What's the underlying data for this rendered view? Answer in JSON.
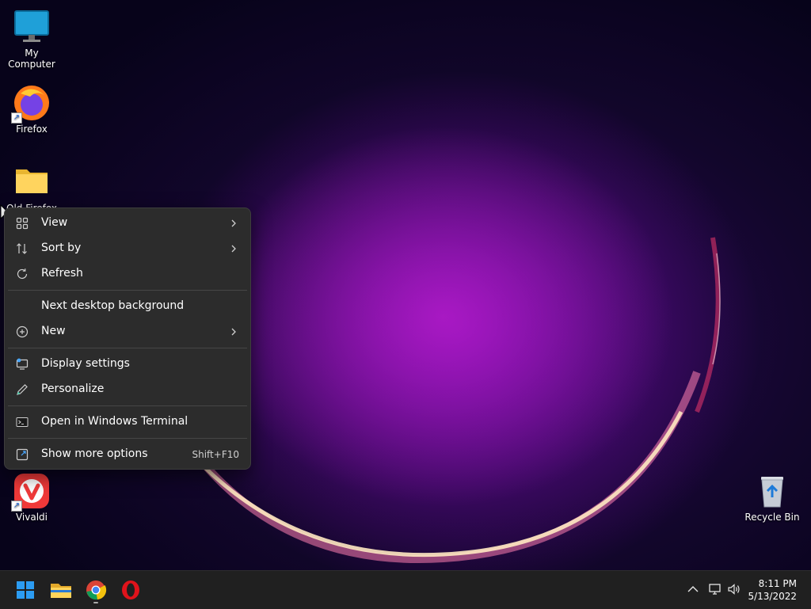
{
  "desktop": {
    "icons": [
      {
        "label": "My Computer"
      },
      {
        "label": "Firefox"
      },
      {
        "label": "Old Firefox"
      },
      {
        "label": "Vivaldi"
      },
      {
        "label": "Recycle Bin"
      }
    ]
  },
  "context_menu": {
    "items": [
      {
        "label": "View",
        "icon": "grid-icon",
        "submenu": true
      },
      {
        "label": "Sort by",
        "icon": "sort-icon",
        "submenu": true
      },
      {
        "label": "Refresh",
        "icon": "refresh-icon"
      },
      {
        "label": "Next desktop background",
        "icon": ""
      },
      {
        "label": "New",
        "icon": "plus-circle-icon",
        "submenu": true
      },
      {
        "label": "Display settings",
        "icon": "display-settings-icon"
      },
      {
        "label": "Personalize",
        "icon": "pencil-icon"
      },
      {
        "label": "Open in Windows Terminal",
        "icon": "terminal-icon"
      },
      {
        "label": "Show more options",
        "icon": "expand-icon",
        "shortcut": "Shift+F10"
      }
    ]
  },
  "taskbar": {
    "pinned": [
      "start-icon",
      "file-explorer-icon",
      "chrome-icon",
      "opera-icon"
    ],
    "tray": [
      "chevron-up-icon",
      "network-icon",
      "volume-icon"
    ],
    "clock": {
      "time": "8:11 PM",
      "date": "5/13/2022"
    }
  },
  "colors": {
    "menu_bg": "#2c2c2c",
    "taskbar_bg": "#202020",
    "accent": "#0a84ff"
  }
}
